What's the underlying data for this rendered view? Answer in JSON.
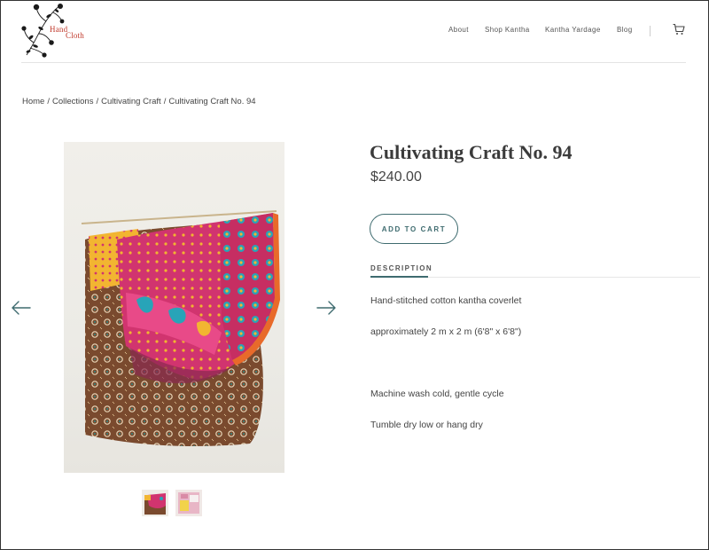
{
  "logo": {
    "line1": "Hand",
    "line2": "Cloth"
  },
  "nav": {
    "items": [
      {
        "label": "About"
      },
      {
        "label": "Shop Kantha"
      },
      {
        "label": "Kantha Yardage"
      },
      {
        "label": "Blog"
      }
    ],
    "cart_icon": "cart-icon"
  },
  "breadcrumb": [
    {
      "label": "Home"
    },
    {
      "label": "Collections"
    },
    {
      "label": "Cultivating Craft"
    },
    {
      "label": "Cultivating Craft No. 94"
    }
  ],
  "breadcrumb_separator": "/",
  "product": {
    "title": "Cultivating Craft No. 94",
    "price": "$240.00",
    "add_to_cart_label": "ADD TO CART",
    "description_tab": "DESCRIPTION",
    "description": [
      "Hand-stitched cotton kantha coverlet",
      "approximately 2 m x 2 m (6'8\" x 6'8\")",
      "Machine wash cold, gentle cycle",
      "Tumble dry low or hang dry"
    ]
  },
  "gallery": {
    "prev_icon": "arrow-left-icon",
    "next_icon": "arrow-right-icon",
    "thumbnail_count": 2
  },
  "colors": {
    "accent": "#3e6b6f",
    "logo_text": "#c0392b",
    "text": "#3a3a3a",
    "quilt_pink": "#d1346f",
    "quilt_brown": "#7a4a2e",
    "quilt_yellow": "#f2b531"
  }
}
